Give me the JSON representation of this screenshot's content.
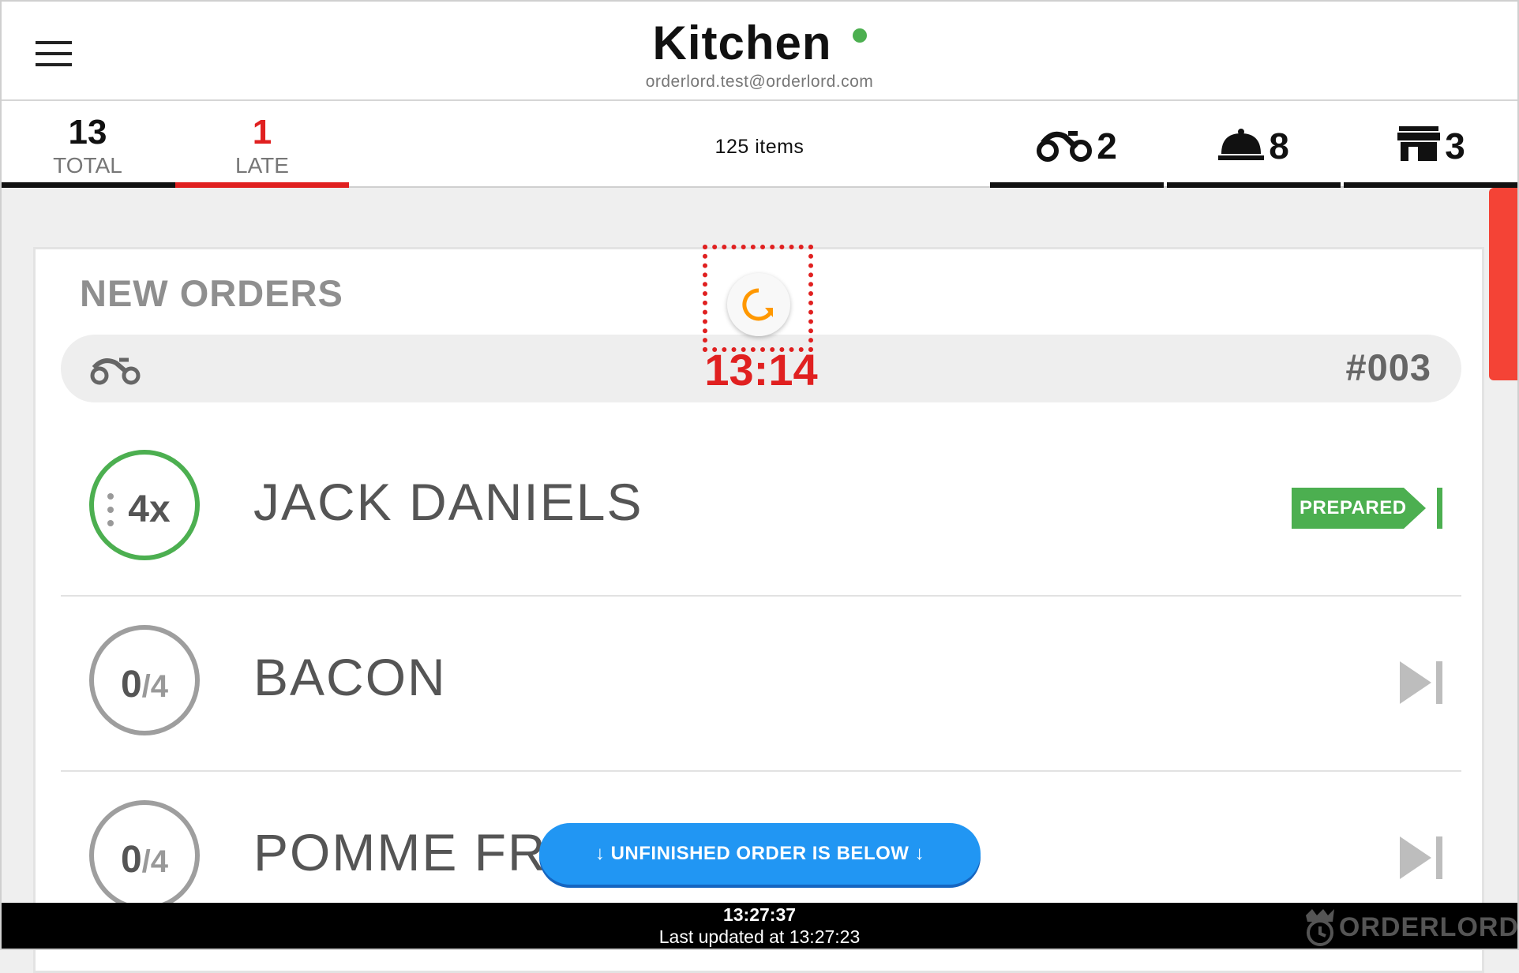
{
  "header": {
    "title": "Kitchen",
    "status_color": "#4caf50",
    "user_email": "orderlord.test@orderlord.com",
    "menu_icon": "hamburger-menu-icon"
  },
  "tabs": {
    "total": {
      "count": "13",
      "label": "TOTAL",
      "color": "#111111"
    },
    "late": {
      "count": "1",
      "label": "LATE",
      "color": "#e02020"
    },
    "items_count": "125 items",
    "delivery": {
      "icon": "scooter-icon",
      "count": "2"
    },
    "dine_in": {
      "icon": "cloche-icon",
      "count": "8"
    },
    "pickup": {
      "icon": "store-icon",
      "count": "3"
    }
  },
  "section": {
    "title": "NEW ORDERS"
  },
  "order": {
    "type_icon": "scooter-icon",
    "time": "13:14",
    "number": "#003"
  },
  "refresh": {
    "icon": "refresh-icon",
    "color": "#ff9800"
  },
  "items": [
    {
      "qty": "4x",
      "name": "JACK DANIELS",
      "state": "prepared",
      "action": "PREPARED",
      "ring_color": "#4caf50"
    },
    {
      "qty_done": "0",
      "qty_total": "/4",
      "name": "BACON",
      "state": "pending",
      "ring_color": "#9e9e9e"
    },
    {
      "qty_done": "0",
      "qty_total": "/4",
      "name": "POMME FRITES",
      "state": "pending",
      "ring_color": "#9e9e9e"
    }
  ],
  "float_button": {
    "label": "↓ UNFINISHED ORDER IS BELOW ↓",
    "color": "#2196f3"
  },
  "footer": {
    "clock": "13:27:37",
    "last_updated": "Last updated at 13:27:23",
    "brand": "ORDERLORD"
  }
}
